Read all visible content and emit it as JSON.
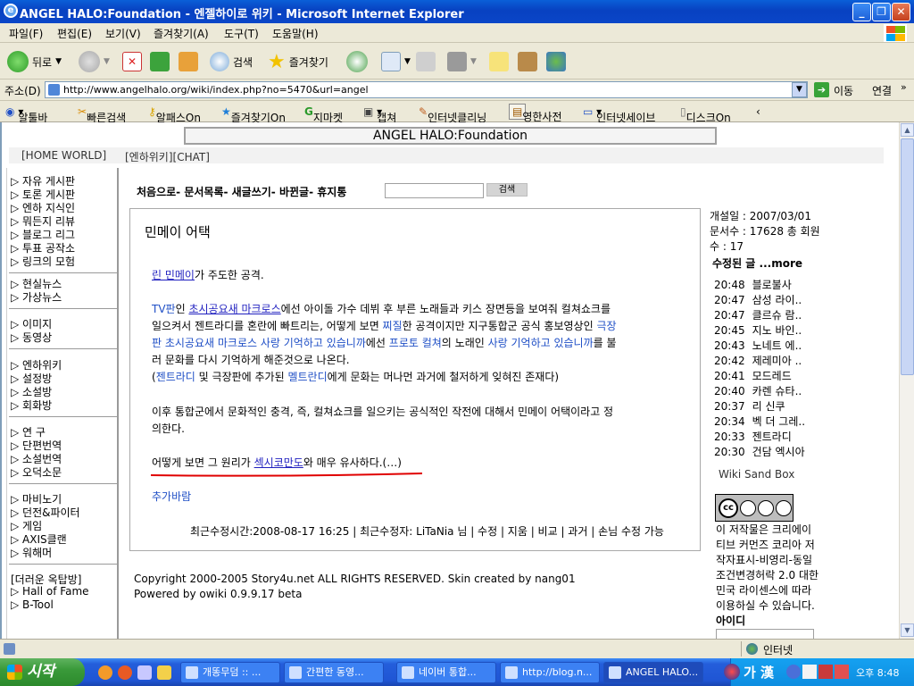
{
  "window": {
    "title": "ANGEL HALO:Foundation - 엔젤하이로 위키 - Microsoft Internet Explorer"
  },
  "menu": [
    "파일(F)",
    "편집(E)",
    "보기(V)",
    "즐겨찾기(A)",
    "도구(T)",
    "도움말(H)"
  ],
  "toolbar": {
    "back": "뒤로",
    "search": "검색",
    "favorites": "즐겨찾기"
  },
  "address": {
    "label": "주소(D)",
    "url": "http://www.angelhalo.org/wiki/index.php?no=5470&url=angel",
    "go": "이동",
    "links": "연결"
  },
  "linkbar": [
    "알툴바",
    "빠른검색",
    "알패스On",
    "즐겨찾기On",
    "지마켓",
    "캡쳐",
    "인터넷클리닝",
    "영한사전",
    "인터넷세이브",
    "디스크On"
  ],
  "site": {
    "title": "ANGEL HALO:Foundation",
    "topnav": "[HOME WORLD]",
    "topnav2": "[엔하위키][CHAT]",
    "menu": "처음으로- 문서목록- 새글쓰기- 바뀐글- 휴지통",
    "search_button": "검색"
  },
  "sidebar": [
    [
      "▷ 자유 게시판",
      "▷ 토론 게시판",
      "▷ 엔하 지식인",
      "▷ 뭐든지 리뷰",
      "▷ 블로그 리그",
      "▷ 투표 공작소",
      "▷ 링크의 모험"
    ],
    [
      "▷ 현실뉴스",
      "▷ 가상뉴스"
    ],
    [
      "▷ 이미지",
      "▷ 동영상"
    ],
    [
      "▷ 엔하위키",
      "▷ 설정방",
      "▷ 소설방",
      "▷ 회화방"
    ],
    [
      "▷ 연 구",
      "▷ 단편번역",
      "▷ 소설번역",
      "▷ 오덕소문"
    ],
    [
      "▷ 마비노기",
      "▷ 던전&파이터",
      "▷ 게임",
      "▷ AXIS클랜",
      "▷ 워해머"
    ],
    [
      "[더러운 옥탑방]",
      "▷ Hall of Fame",
      "▷ B-Tool"
    ]
  ],
  "article": {
    "title": "민메이 어택",
    "p1": {
      "link": "린 민메이",
      "text": "가 주도한 공격."
    },
    "p2": [
      {
        "a": "TV판",
        "b": "인 ",
        "c": "초시공요새 마크로스",
        "d": "에선 아이돌 가수 데뷔 후 부른 노래들과 키스 장면등을 보여줘 컬쳐쇼크를"
      },
      {
        "a": "일으켜서 젠트라디를 혼란에 빠트리는, 어떻게 보면 ",
        "b": "찌질",
        "c": "한 공격이지만 지구통합군 공식 홍보영상인 ",
        "d": "극장"
      },
      {
        "a": "판 초시공요새 마크로스 사랑 기억하고 있습니까",
        "b": "에선 ",
        "c": "프로토 컬쳐",
        "d": "의 노래인 ",
        "e": "사랑 기억하고 있습니까",
        "f": "를 불"
      },
      {
        "a": "러 문화를 다시 기억하게 해준것으로 나온다."
      },
      {
        "a": "(",
        "b": "젠트라디",
        "c": " 및 극장판에 추가된 ",
        "d": "멜트란디",
        "e": "에게 문화는 머나먼 과거에 철저하게 잊혀진 존재다)"
      }
    ],
    "p3": [
      "이후 통합군에서 문화적인 충격, 즉, 컬쳐쇼크를 일으키는 공식적인 작전에 대해서 민메이 어택이라고 정",
      "의한다."
    ],
    "p4": {
      "a": "어떻게 보면 그 원리가 ",
      "b": "섹시코만도",
      "c": "와 매우 유사하다.(…)"
    },
    "more": "추가바람",
    "footer": "최근수정시간:2008-08-17 16:25 | 최근수정자: LiTaNia 님 | 수정 | 지움 | 비교 | 과거 | 손님 수정 가능"
  },
  "copyright": [
    "Copyright 2000-2005 Story4u.net ALL RIGHTS RESERVED. Skin created by nang01",
    "Powered by owiki 0.9.9.17 beta"
  ],
  "right": {
    "info": [
      "개설일 : 2007/03/01",
      "문서수 : 17628 총 회원",
      "수 : 17"
    ],
    "recent_title": "수정된 글 ...more",
    "recent": [
      [
        "20:48",
        "블로불사"
      ],
      [
        "20:47",
        "삼성 라이.."
      ],
      [
        "20:47",
        "클르슈 람.."
      ],
      [
        "20:45",
        "지노 바인.."
      ],
      [
        "20:43",
        "노네트 에.."
      ],
      [
        "20:42",
        "제레미아 .."
      ],
      [
        "20:41",
        "모드레드"
      ],
      [
        "20:40",
        "카렌 슈타.."
      ],
      [
        "20:37",
        "리 신쿠"
      ],
      [
        "20:34",
        "벡 더 그레.."
      ],
      [
        "20:33",
        "젠트라디"
      ],
      [
        "20:30",
        "건담 엑시아"
      ]
    ],
    "sandbox": "Wiki Sand Box",
    "cc": [
      "이 저작물은 크리에이",
      "티브 커먼즈 코리아 저",
      "작자표시-비영리-동일",
      "조건변경허락 2.0 대한",
      "민국 라이센스에 따라",
      "이용하실 수 있습니다."
    ],
    "id_label": "아이디"
  },
  "status": {
    "zone": "인터넷"
  },
  "taskbar": {
    "start": "시작",
    "tasks": [
      "개똥무덤 :: ...",
      "간편한 동영...",
      "네이버 통합...",
      "http://blog.n...",
      "ANGEL HALO..."
    ],
    "lang": "가 漢",
    "clock": "오후 8:48"
  },
  "colors": {
    "link": "#1f1fbf",
    "underline_mark": "#e00000",
    "title_bar": "#0a46c8"
  }
}
